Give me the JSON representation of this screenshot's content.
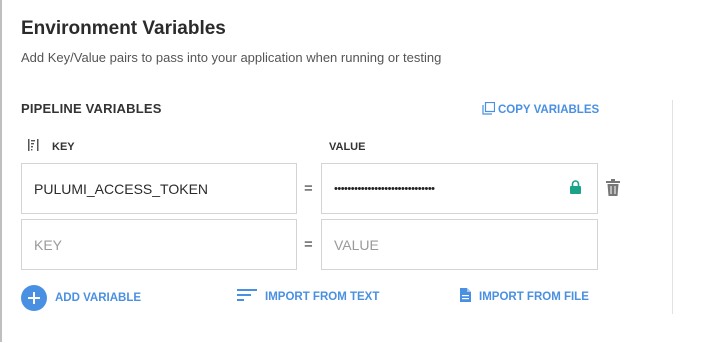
{
  "header": {
    "title": "Environment Variables",
    "subtitle": "Add Key/Value pairs to pass into your application when running or testing"
  },
  "pipeline": {
    "section_title": "PIPELINE VARIABLES",
    "copy_label": "COPY VARIABLES",
    "columns": {
      "key": "KEY",
      "value": "VALUE"
    },
    "rows": [
      {
        "key": "PULUMI_ACCESS_TOKEN",
        "equals": "=",
        "value_masked": "••••••••••••••••••••••••••••••"
      }
    ],
    "new_row": {
      "key_placeholder": "KEY",
      "equals": "=",
      "value_placeholder": "VALUE"
    }
  },
  "actions": {
    "add_variable": "ADD VARIABLE",
    "import_text": "IMPORT FROM TEXT",
    "import_file": "IMPORT FROM FILE"
  },
  "icons": {
    "copy": "copy-icon",
    "sort": "sort-icon",
    "lock": "lock-icon",
    "trash": "trash-icon",
    "add": "plus-circle-icon",
    "text": "text-lines-icon",
    "file": "file-icon"
  },
  "colors": {
    "accent": "#4a90e2",
    "lock": "#1aa38a",
    "icon_gray": "#777777"
  }
}
